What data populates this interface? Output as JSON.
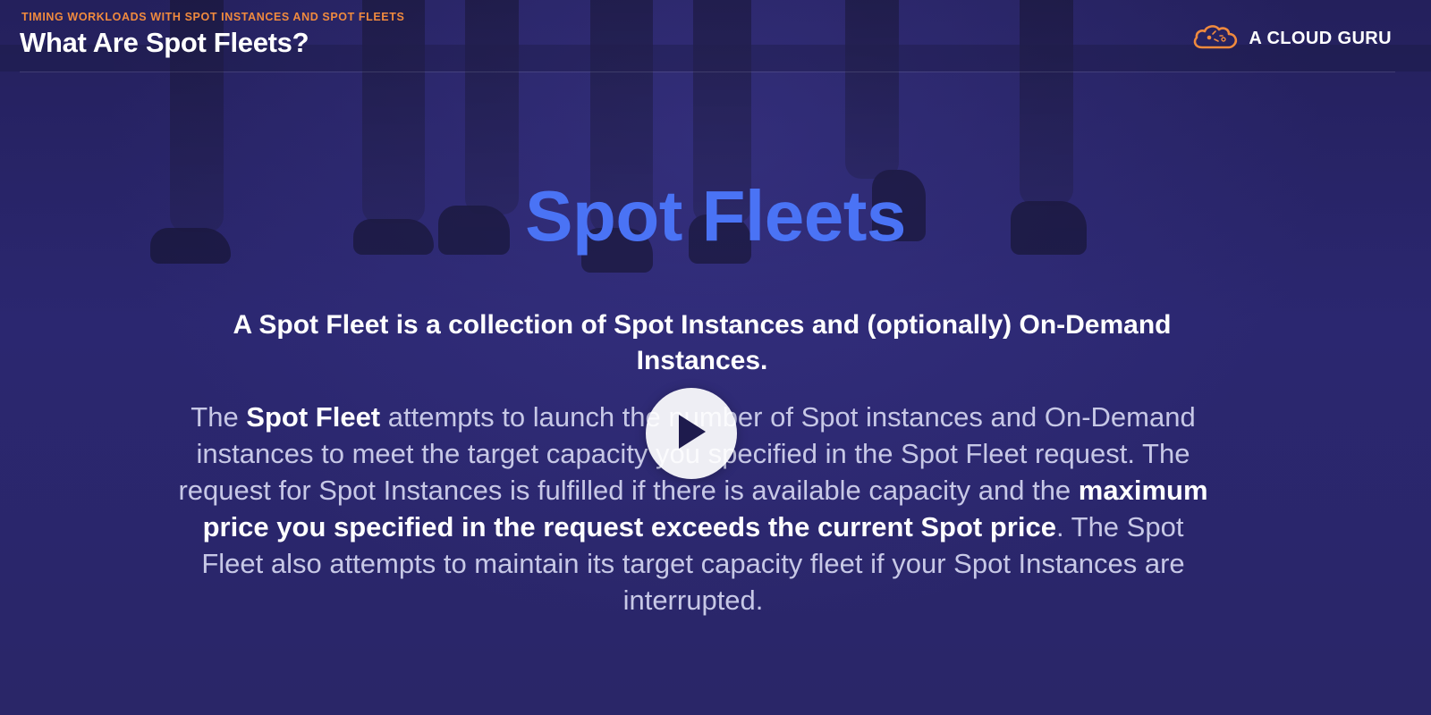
{
  "header": {
    "kicker": "TIMING WORKLOADS WITH SPOT INSTANCES AND SPOT FLEETS",
    "title": "What Are Spot Fleets?"
  },
  "brand": {
    "name": "A CLOUD GURU",
    "icon": "cloud-logo-icon",
    "accent_color": "#f08a3e"
  },
  "slide": {
    "big_title": "Spot Fleets",
    "big_title_color": "#4a73f5",
    "lead": "A Spot Fleet is a collection of Spot Instances and (optionally) On-Demand Instances.",
    "body": [
      {
        "text": "The ",
        "bold": false
      },
      {
        "text": "Spot Fleet",
        "bold": true
      },
      {
        "text": " attempts to launch the number of Spot instances and On-Demand instances to meet the target capacity you specified in the Spot Fleet request. The request for Spot Instances is fulfilled if there is available capacity and the ",
        "bold": false
      },
      {
        "text": "maximum price you specified in the request exceeds the current Spot price",
        "bold": true
      },
      {
        "text": ". The Spot Fleet also attempts to maintain its target capacity fleet if your Spot Instances are interrupted.",
        "bold": false
      }
    ]
  },
  "player": {
    "play_icon": "play-icon"
  }
}
